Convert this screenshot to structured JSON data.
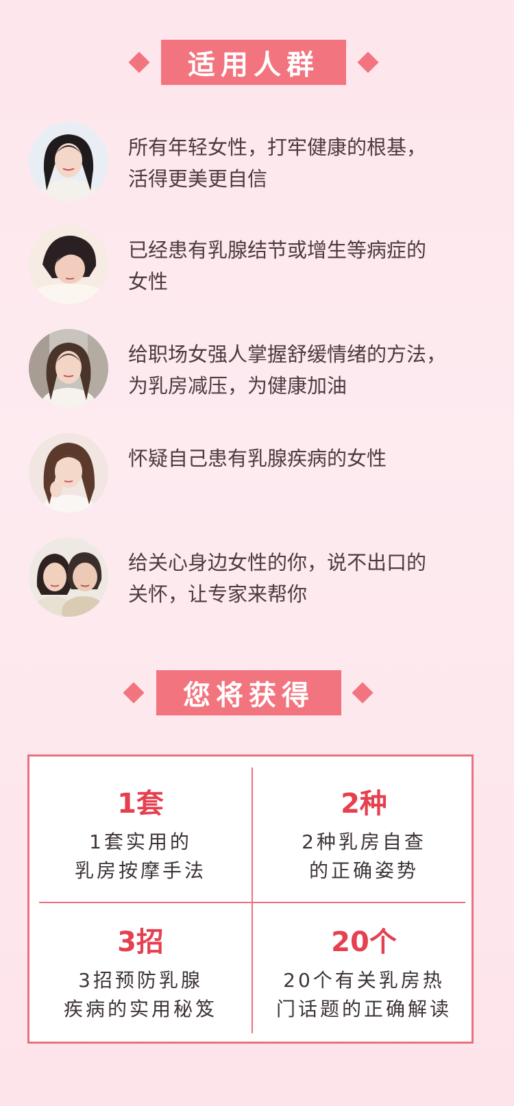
{
  "section_audience": {
    "title": "适用人群",
    "items": [
      {
        "text_line1": "所有年轻女性，打牢健康的根基，",
        "text_line2": "活得更美更自信"
      },
      {
        "text_line1": "已经患有乳腺结节或增生等病症的",
        "text_line2": "女性"
      },
      {
        "text_line1": "给职场女强人掌握舒缓情绪的方法，",
        "text_line2": "为乳房减压，为健康加油"
      },
      {
        "text_line1": "怀疑自己患有乳腺疾病的女性",
        "text_line2": ""
      },
      {
        "text_line1": "给关心身边女性的你，说不出口的",
        "text_line2": "关怀，让专家来帮你"
      }
    ]
  },
  "section_benefits": {
    "title": "您将获得",
    "cells": [
      {
        "big": "1套",
        "line1": "1套实用的",
        "line2": "乳房按摩手法"
      },
      {
        "big": "2种",
        "line1": "2种乳房自查",
        "line2": "的正确姿势"
      },
      {
        "big": "3招",
        "line1": "3招预防乳腺",
        "line2": "疾病的实用秘笈"
      },
      {
        "big": "20个",
        "line1": "20个有关乳房热",
        "line2": "门话题的正确解读"
      }
    ]
  },
  "colors": {
    "accent": "#f2747e",
    "highlight": "#e5404f",
    "background": "#fde6ec"
  }
}
